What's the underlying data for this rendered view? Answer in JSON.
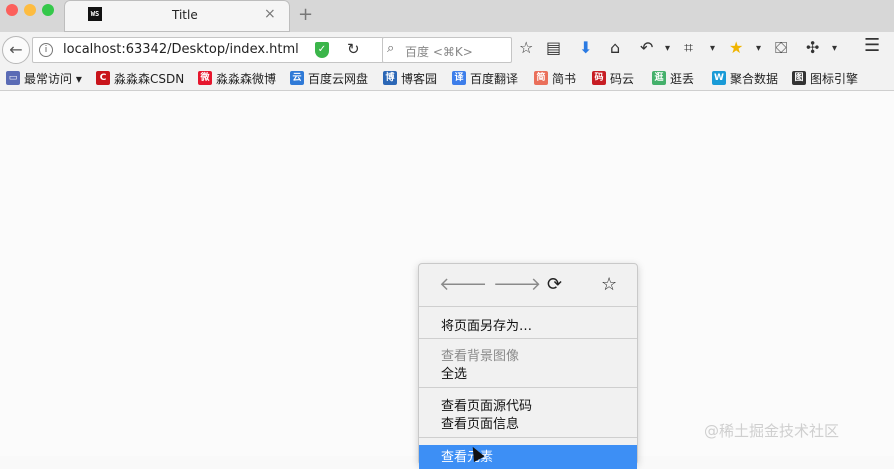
{
  "window": {
    "controls": {
      "close_color": "#fc605c",
      "minimize_color": "#fdbc40",
      "maximize_color": "#34c84a"
    }
  },
  "tab": {
    "favicon": "WS",
    "title": "Title",
    "close": "×",
    "new_tab": "+"
  },
  "navbar": {
    "back_icon": "←",
    "info_icon": "i",
    "url": "localhost:63342/Desktop/index.html",
    "shield_icon": "✓",
    "reload_icon": "↻",
    "search_placeholder": "百度 <⌘K>",
    "toolbar_icons": [
      "☆",
      "▤",
      "⬇",
      "⌂",
      "↶",
      "▾",
      "⌗",
      "▾",
      "★",
      "▾",
      "⛋",
      "✣",
      "▾",
      "☰"
    ]
  },
  "bookmarks": [
    {
      "icon": "▭",
      "label": "最常访问 ▾",
      "color": "#5a6bb5"
    },
    {
      "icon": "C",
      "label": "淼淼森CSDN",
      "color": "#c9141b"
    },
    {
      "icon": "微",
      "label": "淼淼森微博",
      "color": "#e6162d"
    },
    {
      "icon": "云",
      "label": "百度云网盘",
      "color": "#2f7ad7"
    },
    {
      "icon": "博",
      "label": "博客园",
      "color": "#2b67b6"
    },
    {
      "icon": "译",
      "label": "百度翻译",
      "color": "#3d7eea"
    },
    {
      "icon": "简",
      "label": "简书",
      "color": "#ea6f5a"
    },
    {
      "icon": "码",
      "label": "码云",
      "color": "#c71d23"
    },
    {
      "icon": "逛",
      "label": "逛丢",
      "color": "#44b06b"
    },
    {
      "icon": "W",
      "label": "聚合数据",
      "color": "#1a9bd7"
    },
    {
      "icon": "图",
      "label": "图标引擎",
      "color": "#333333"
    }
  ],
  "context_menu": {
    "nav": {
      "back": "🡐",
      "forward": "🡒",
      "reload": "⟳",
      "bookmark": "☆"
    },
    "items": [
      {
        "label": "将页面另存为…",
        "disabled": false
      },
      {
        "label": "查看背景图像",
        "disabled": true
      },
      {
        "label": "全选",
        "disabled": false
      },
      {
        "label": "查看页面源代码",
        "disabled": false
      },
      {
        "label": "查看页面信息",
        "disabled": false
      },
      {
        "label": "查看元素",
        "disabled": false,
        "highlighted": true
      }
    ]
  },
  "watermark": "@稀土掘金技术社区"
}
